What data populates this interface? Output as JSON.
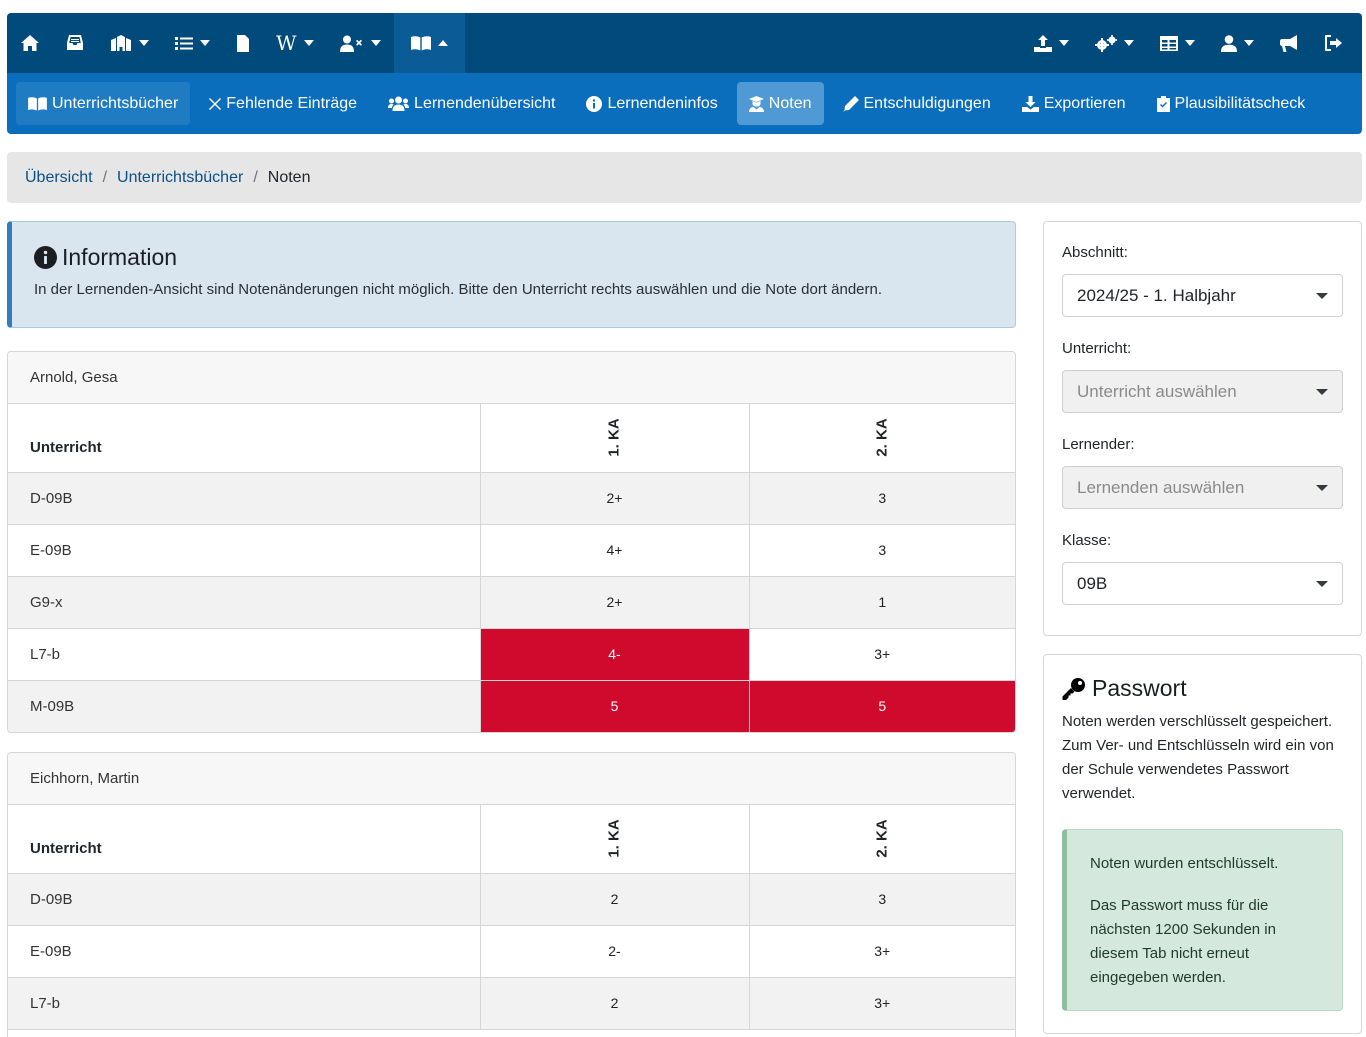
{
  "topnav": {
    "icons": [
      "home-icon",
      "inbox-icon",
      "school-icon",
      "list-icon",
      "document-icon",
      "wiki-icon",
      "user-times-icon",
      "book-open-icon",
      "upload-icon",
      "cogs-icon",
      "table-icon",
      "user-icon",
      "bullhorn-icon",
      "logout-icon"
    ],
    "wiki_glyph": "W"
  },
  "subnav": {
    "items": [
      {
        "label": "Unterrichtsbücher",
        "icon": "book-open-icon"
      },
      {
        "label": "Fehlende Einträge",
        "icon": "times-icon"
      },
      {
        "label": "Lernendenübersicht",
        "icon": "users-icon"
      },
      {
        "label": "Lernendeninfos",
        "icon": "info-circle-icon"
      },
      {
        "label": "Noten",
        "icon": "graduate-icon"
      },
      {
        "label": "Entschuldigungen",
        "icon": "pen-icon"
      },
      {
        "label": "Exportieren",
        "icon": "download-icon"
      },
      {
        "label": "Plausibilitätscheck",
        "icon": "clipboard-check-icon"
      }
    ]
  },
  "breadcrumb": {
    "items": [
      "Übersicht",
      "Unterrichtsbücher"
    ],
    "separator": "/",
    "current": "Noten"
  },
  "info": {
    "title": "Information",
    "text": "In der Lernenden-Ansicht sind Notenänderungen nicht möglich. Bitte den Unterricht rechts auswählen und die Note dort ändern."
  },
  "students": [
    {
      "name": "Arnold, Gesa",
      "col_header": "Unterricht",
      "ka1": "1. KA",
      "ka2": "2. KA",
      "rows": [
        {
          "subject": "D-09B",
          "g1": "2+",
          "g2": "3"
        },
        {
          "subject": "E-09B",
          "g1": "4+",
          "g2": "3"
        },
        {
          "subject": "G9-x",
          "g1": "2+",
          "g2": "1"
        },
        {
          "subject": "L7-b",
          "g1": "4-",
          "g2": "3+"
        },
        {
          "subject": "M-09B",
          "g1": "5",
          "g2": "5"
        }
      ]
    },
    {
      "name": "Eichhorn, Martin",
      "col_header": "Unterricht",
      "ka1": "1. KA",
      "ka2": "2. KA",
      "rows": [
        {
          "subject": "D-09B",
          "g1": "2",
          "g2": "3"
        },
        {
          "subject": "E-09B",
          "g1": "2-",
          "g2": "3+"
        },
        {
          "subject": "L7-b",
          "g1": "2",
          "g2": "3+"
        }
      ]
    }
  ],
  "filters": {
    "abschnitt": {
      "label": "Abschnitt:",
      "value": "2024/25 - 1. Halbjahr"
    },
    "unterricht": {
      "label": "Unterricht:",
      "placeholder": "Unterricht auswählen"
    },
    "lernender": {
      "label": "Lernender:",
      "placeholder": "Lernenden auswählen"
    },
    "klasse": {
      "label": "Klasse:",
      "value": "09B"
    }
  },
  "password": {
    "title": "Passwort",
    "text": "Noten werden verschlüsselt gespeichert. Zum Ver- und Entschlüsseln wird ein von der Schule verwendetes Passwort verwendet.",
    "success1": "Noten wurden entschlüsselt.",
    "success2": "Das Passwort muss für die nächsten 1200 Sekunden in diesem Tab nicht erneut eingegeben werden."
  },
  "colors": {
    "nav": "#004a7c",
    "subnav": "#0a6ebd",
    "bad_grade": "#cf0a2c",
    "success_bg": "#d4e8de"
  }
}
